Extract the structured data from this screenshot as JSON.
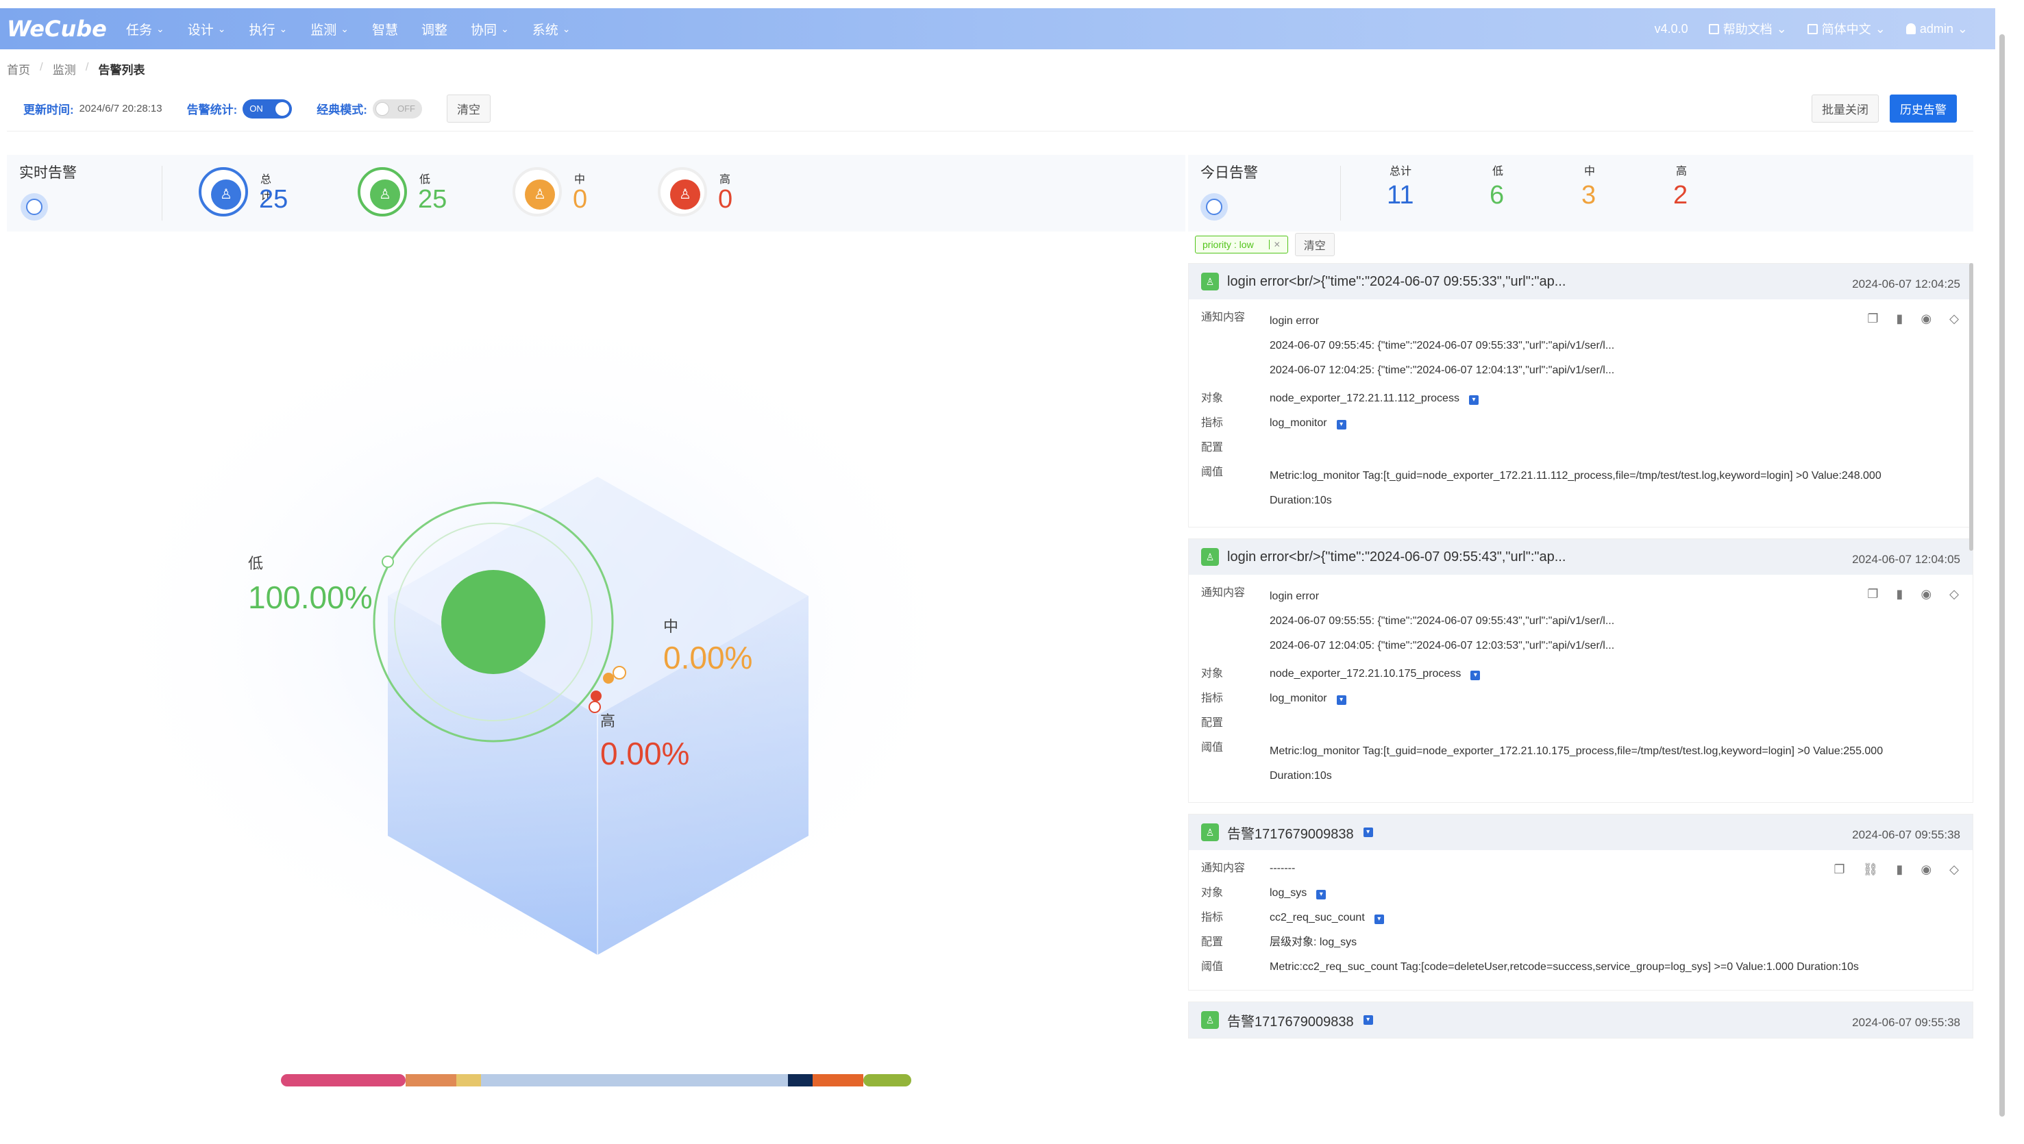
{
  "app": {
    "logo": "WeCube",
    "version": "v4.0.0",
    "help": "帮助文档",
    "language": "简体中文",
    "user": "admin",
    "menu": [
      {
        "label": "任务",
        "has_dropdown": true
      },
      {
        "label": "设计",
        "has_dropdown": true
      },
      {
        "label": "执行",
        "has_dropdown": true
      },
      {
        "label": "监测",
        "has_dropdown": true
      },
      {
        "label": "智慧",
        "has_dropdown": false
      },
      {
        "label": "调整",
        "has_dropdown": false
      },
      {
        "label": "协同",
        "has_dropdown": true
      },
      {
        "label": "系统",
        "has_dropdown": true
      }
    ]
  },
  "breadcrumb": [
    "首页",
    "监测",
    "告警列表"
  ],
  "controls": {
    "update_label": "更新时间:",
    "update_value": "2024/6/7 20:28:13",
    "stats_label": "告警统计:",
    "stats_switch": "ON",
    "classic_label": "经典模式:",
    "classic_switch": "OFF",
    "clear": "清空",
    "batch_close": "批量关闭",
    "history": "历史告警"
  },
  "realtime": {
    "title": "实时告警",
    "total_label": "总计",
    "total": "25",
    "low_label": "低",
    "low": "25",
    "mid_label": "中",
    "mid": "0",
    "high_label": "高",
    "high": "0"
  },
  "today": {
    "title": "今日告警",
    "total_label": "总计",
    "total": "11",
    "low_label": "低",
    "low": "6",
    "mid_label": "中",
    "mid": "3",
    "high_label": "高",
    "high": "2"
  },
  "filter": {
    "tag": "priority : low",
    "clear": "清空"
  },
  "chart_data": {
    "type": "pie",
    "slices": [
      {
        "name": "低",
        "percent": "100.00%",
        "value": 100,
        "color": "#5cc05c"
      },
      {
        "name": "中",
        "percent": "0.00%",
        "value": 0,
        "color": "#f0a23c"
      },
      {
        "name": "高",
        "percent": "0.00%",
        "value": 0,
        "color": "#e2472f"
      }
    ]
  },
  "colorbar": [
    "#d94a78",
    "#e08a55",
    "#e6c66a",
    "#b7cbe6",
    "#0f2a54",
    "#e4652a",
    "#93b43a"
  ],
  "field_labels": {
    "content": "通知内容",
    "object": "对象",
    "metric": "指标",
    "config": "配置",
    "threshold": "阈值"
  },
  "alarms": [
    {
      "title": "login error<br/>{\"time\":\"2024-06-07 09:55:33\",\"url\":\"ap...",
      "time": "2024-06-07 12:04:25",
      "content": [
        "login error",
        "2024-06-07 09:55:45: {\"time\":\"2024-06-07 09:55:33\",\"url\":\"api/v1/ser/l...",
        "2024-06-07 12:04:25: {\"time\":\"2024-06-07 12:04:13\",\"url\":\"api/v1/ser/l..."
      ],
      "object": "node_exporter_172.21.11.112_process",
      "metric": "log_monitor",
      "config": "",
      "threshold": "Metric:log_monitor Tag:[t_guid=node_exporter_172.21.11.112_process,file=/tmp/test/test.log,keyword=login] >0 Value:248.000",
      "duration": "Duration:10s"
    },
    {
      "title": "login error<br/>{\"time\":\"2024-06-07 09:55:43\",\"url\":\"ap...",
      "time": "2024-06-07 12:04:05",
      "content": [
        "login error",
        "2024-06-07 09:55:55: {\"time\":\"2024-06-07 09:55:43\",\"url\":\"api/v1/ser/l...",
        "2024-06-07 12:04:05: {\"time\":\"2024-06-07 12:03:53\",\"url\":\"api/v1/ser/l..."
      ],
      "object": "node_exporter_172.21.10.175_process",
      "metric": "log_monitor",
      "config": "",
      "threshold": "Metric:log_monitor Tag:[t_guid=node_exporter_172.21.10.175_process,file=/tmp/test/test.log,keyword=login] >0 Value:255.000",
      "duration": "Duration:10s"
    },
    {
      "title": "告警1717679009838",
      "time": "2024-06-07 09:55:38",
      "content": [
        "-------"
      ],
      "object": "log_sys",
      "metric": "cc2_req_suc_count",
      "config": "层级对象: log_sys",
      "threshold": "Metric:cc2_req_suc_count Tag:[code=deleteUser,retcode=success,service_group=log_sys] >=0 Value:1.000 Duration:10s",
      "duration": ""
    },
    {
      "title": "告警1717679009838",
      "time": "2024-06-07 09:55:38"
    }
  ]
}
